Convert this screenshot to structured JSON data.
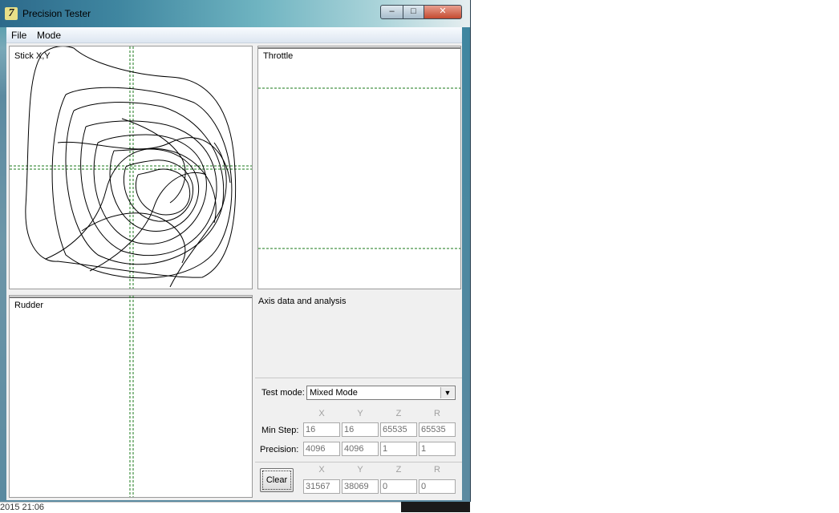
{
  "window": {
    "title": "Precision Tester",
    "icon_glyph": "7"
  },
  "menu": {
    "file": "File",
    "mode": "Mode"
  },
  "panels": {
    "stick": "Stick X,Y",
    "throttle": "Throttle",
    "rudder": "Rudder",
    "analysis": "Axis data and analysis"
  },
  "test_mode": {
    "label": "Test mode:",
    "value": "Mixed Mode"
  },
  "columns": [
    "X",
    "Y",
    "Z",
    "R"
  ],
  "min_step": {
    "label": "Min Step:",
    "values": [
      "16",
      "16",
      "65535",
      "65535"
    ]
  },
  "precision": {
    "label": "Precision:",
    "values": [
      "4096",
      "4096",
      "1",
      "1"
    ]
  },
  "current": {
    "values": [
      "31567",
      "38069",
      "0",
      "0"
    ]
  },
  "buttons": {
    "clear": "Clear"
  },
  "taskbar": {
    "clock": "2015 21:06"
  },
  "colors": {
    "guide": "#1a7a1a",
    "trace": "#000000"
  }
}
